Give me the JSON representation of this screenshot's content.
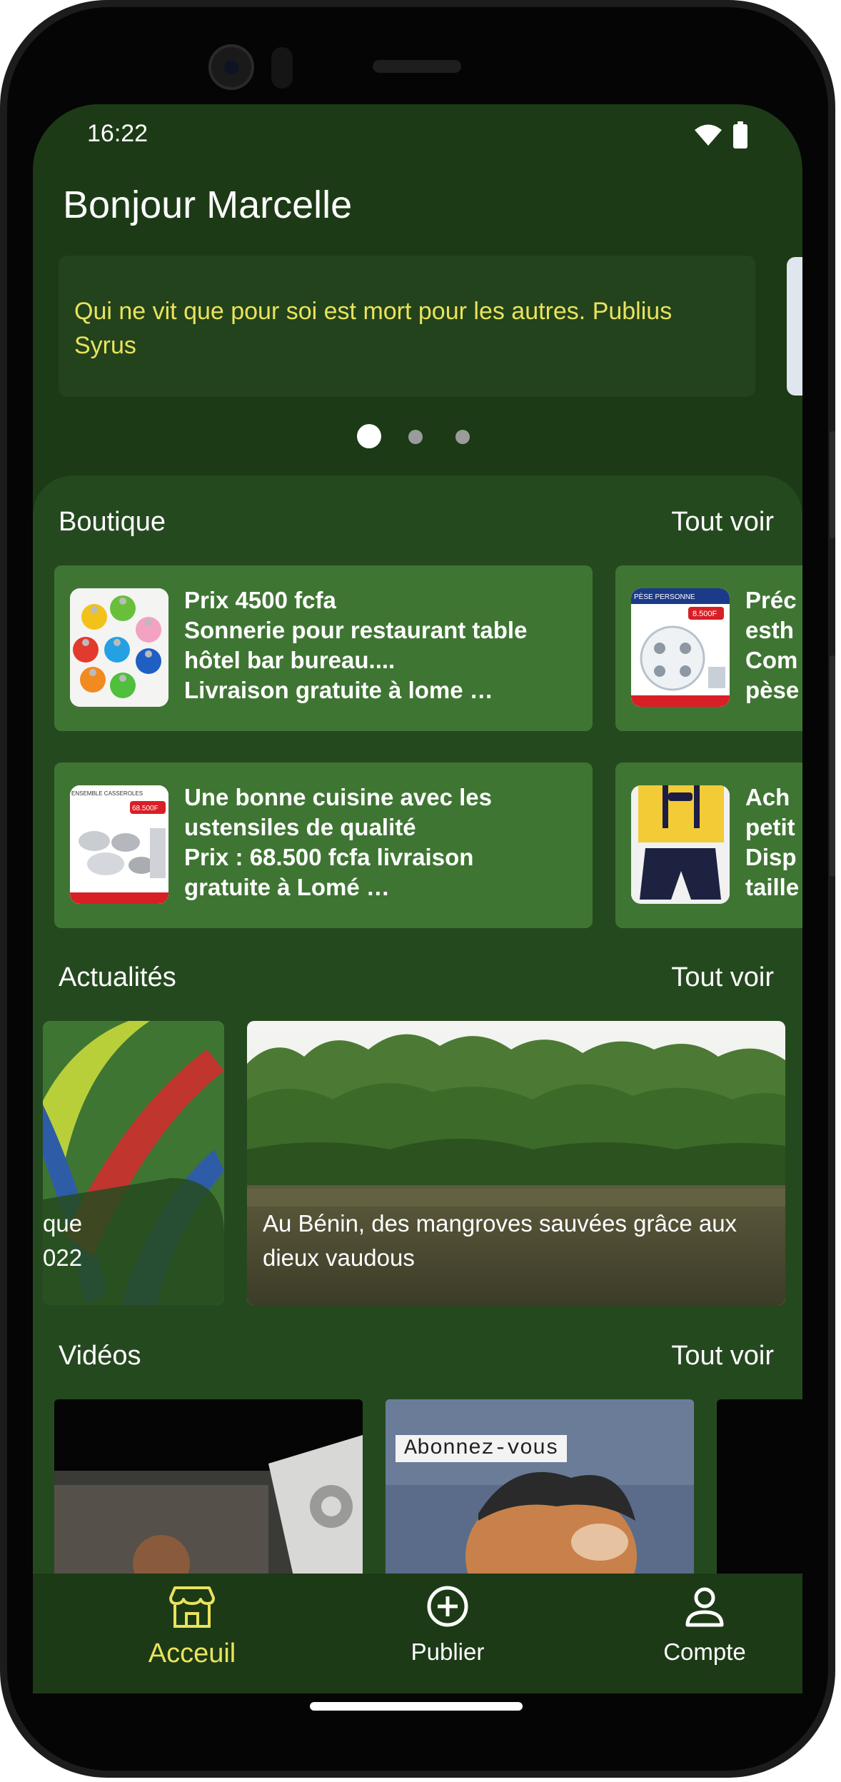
{
  "status_bar": {
    "time": "16:22"
  },
  "header": {
    "greeting": "Bonjour Marcelle"
  },
  "quote": {
    "text": "Qui ne vit que pour soi est mort pour les autres. Publius Syrus",
    "active_index": 0,
    "count": 3
  },
  "boutique": {
    "title": "Boutique",
    "see_all": "Tout voir",
    "items": [
      {
        "text": "Prix 4500 fcfa\nSonnerie pour restaurant table\nhôtel bar bureau....\nLivraison gratuite à lome  …",
        "thumb": "bells-icon"
      },
      {
        "text": "Préc\nesth\nCom\npèse",
        "thumb": "scale-icon"
      },
      {
        "text": "Une bonne cuisine avec les\nustensiles de qualité\nPrix : 68.500 fcfa livraison\ngratuite à Lomé  …",
        "thumb": "cookware-icon",
        "badge": "68.500F",
        "banner": "ENSEMBLE CASSEROLES"
      },
      {
        "text": "Ach\npetit\nDisp\ntaille",
        "thumb": "kids-outfit-icon"
      }
    ],
    "scale_badge": "8.500F",
    "scale_banner": "PÈSE PERSONNE"
  },
  "actualites": {
    "title": "Actualités",
    "see_all": "Tout voir",
    "items": [
      {
        "caption": "que\n022",
        "image": "logo-graphic"
      },
      {
        "caption": "Au Bénin, des mangroves sauvées grâce aux dieux vaudous",
        "image": "mangrove-photo"
      }
    ]
  },
  "videos": {
    "title": "Vidéos",
    "see_all": "Tout voir",
    "items": [
      {
        "image": "video-thumbnail-1"
      },
      {
        "image": "video-thumbnail-2",
        "overlay_text": "Abonnez-vous"
      },
      {
        "image": "video-thumbnail-3"
      }
    ]
  },
  "bottom_nav": {
    "items": [
      {
        "label": "Acceuil",
        "icon": "store-icon",
        "active": true
      },
      {
        "label": "Publier",
        "icon": "add-circle-icon",
        "active": false
      },
      {
        "label": "Compte",
        "icon": "person-icon",
        "active": false
      }
    ]
  },
  "colors": {
    "background": "#1c3a16",
    "content": "#25491f",
    "card": "#3f7533",
    "quote_text": "#e9e35d",
    "active_nav": "#e9e35d"
  }
}
